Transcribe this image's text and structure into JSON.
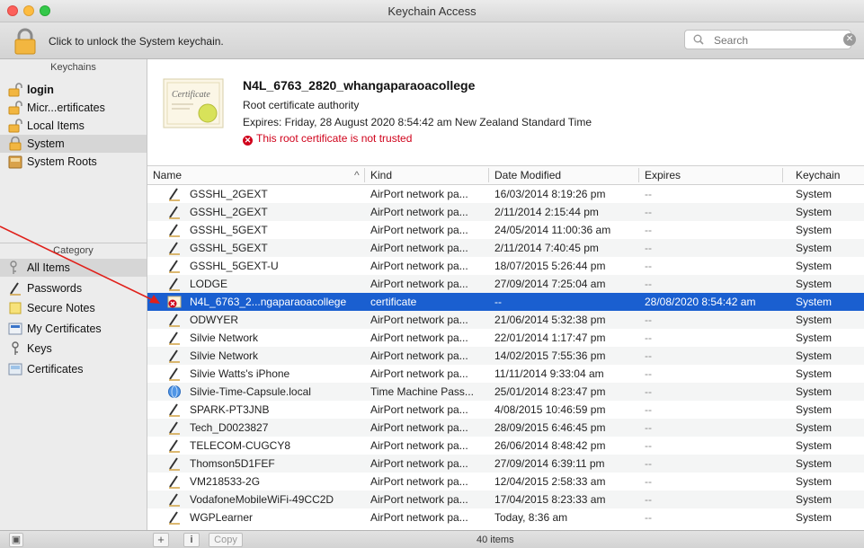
{
  "window": {
    "title": "Keychain Access"
  },
  "toolbar": {
    "unlock_text": "Click to unlock the System keychain.",
    "search_placeholder": "Search"
  },
  "sidebar": {
    "keychains_header": "Keychains",
    "keychains": [
      {
        "label": "login",
        "icon": "lock-open-icon",
        "bold": true
      },
      {
        "label": "Micr...ertificates",
        "icon": "lock-open-icon"
      },
      {
        "label": "Local Items",
        "icon": "lock-open-icon"
      },
      {
        "label": "System",
        "icon": "lock-closed-icon",
        "selected": true
      },
      {
        "label": "System Roots",
        "icon": "cabinet-icon"
      }
    ],
    "category_header": "Category",
    "categories": [
      {
        "label": "All Items",
        "icon": "keys-icon",
        "selected": true
      },
      {
        "label": "Passwords",
        "icon": "pen-icon"
      },
      {
        "label": "Secure Notes",
        "icon": "note-icon"
      },
      {
        "label": "My Certificates",
        "icon": "cert-icon"
      },
      {
        "label": "Keys",
        "icon": "key-icon"
      },
      {
        "label": "Certificates",
        "icon": "certificate-icon"
      }
    ]
  },
  "cert_info": {
    "name": "N4L_6763_2820_whangaparaoacollege",
    "type": "Root certificate authority",
    "expires": "Expires: Friday, 28 August 2020 8:54:42 am New Zealand Standard Time",
    "warning": "This root certificate is not trusted",
    "thumb_text": "Certificate"
  },
  "table": {
    "columns": [
      "Name",
      "Kind",
      "Date Modified",
      "Expires",
      "Keychain"
    ],
    "rows": [
      {
        "name": "GSSHL_2GEXT",
        "kind": "AirPort network pa...",
        "date": "16/03/2014 8:19:26 pm",
        "expires": "--",
        "keychain": "System",
        "icon": "pen-icon"
      },
      {
        "name": "GSSHL_2GEXT",
        "kind": "AirPort network pa...",
        "date": "2/11/2014 2:15:44 pm",
        "expires": "--",
        "keychain": "System",
        "icon": "pen-icon"
      },
      {
        "name": "GSSHL_5GEXT",
        "kind": "AirPort network pa...",
        "date": "24/05/2014 11:00:36 am",
        "expires": "--",
        "keychain": "System",
        "icon": "pen-icon"
      },
      {
        "name": "GSSHL_5GEXT",
        "kind": "AirPort network pa...",
        "date": "2/11/2014 7:40:45 pm",
        "expires": "--",
        "keychain": "System",
        "icon": "pen-icon"
      },
      {
        "name": "GSSHL_5GEXT-U",
        "kind": "AirPort network pa...",
        "date": "18/07/2015 5:26:44 pm",
        "expires": "--",
        "keychain": "System",
        "icon": "pen-icon"
      },
      {
        "name": "LODGE",
        "kind": "AirPort network pa...",
        "date": "27/09/2014 7:25:04 am",
        "expires": "--",
        "keychain": "System",
        "icon": "pen-icon"
      },
      {
        "name": "N4L_6763_2...ngaparaoacollege",
        "kind": "certificate",
        "date": "--",
        "expires": "28/08/2020 8:54:42 am",
        "keychain": "System",
        "icon": "cert-untrusted-icon",
        "selected": true
      },
      {
        "name": "ODWYER",
        "kind": "AirPort network pa...",
        "date": "21/06/2014 5:32:38 pm",
        "expires": "--",
        "keychain": "System",
        "icon": "pen-icon"
      },
      {
        "name": "Silvie Network",
        "kind": "AirPort network pa...",
        "date": "22/01/2014 1:17:47 pm",
        "expires": "--",
        "keychain": "System",
        "icon": "pen-icon"
      },
      {
        "name": "Silvie Network",
        "kind": "AirPort network pa...",
        "date": "14/02/2015 7:55:36 pm",
        "expires": "--",
        "keychain": "System",
        "icon": "pen-icon"
      },
      {
        "name": "Silvie Watts's iPhone",
        "kind": "AirPort network pa...",
        "date": "11/11/2014 9:33:04 am",
        "expires": "--",
        "keychain": "System",
        "icon": "pen-icon"
      },
      {
        "name": "Silvie-Time-Capsule.local",
        "kind": "Time Machine Pass...",
        "date": "25/01/2014 8:23:47 pm",
        "expires": "--",
        "keychain": "System",
        "icon": "globe-icon"
      },
      {
        "name": "SPARK-PT3JNB",
        "kind": "AirPort network pa...",
        "date": "4/08/2015 10:46:59 pm",
        "expires": "--",
        "keychain": "System",
        "icon": "pen-icon"
      },
      {
        "name": "Tech_D0023827",
        "kind": "AirPort network pa...",
        "date": "28/09/2015 6:46:45 pm",
        "expires": "--",
        "keychain": "System",
        "icon": "pen-icon"
      },
      {
        "name": "TELECOM-CUGCY8",
        "kind": "AirPort network pa...",
        "date": "26/06/2014 8:48:42 pm",
        "expires": "--",
        "keychain": "System",
        "icon": "pen-icon"
      },
      {
        "name": "Thomson5D1FEF",
        "kind": "AirPort network pa...",
        "date": "27/09/2014 6:39:11 pm",
        "expires": "--",
        "keychain": "System",
        "icon": "pen-icon"
      },
      {
        "name": "VM218533-2G",
        "kind": "AirPort network pa...",
        "date": "12/04/2015 2:58:33 am",
        "expires": "--",
        "keychain": "System",
        "icon": "pen-icon"
      },
      {
        "name": "VodafoneMobileWiFi-49CC2D",
        "kind": "AirPort network pa...",
        "date": "17/04/2015 8:23:33 am",
        "expires": "--",
        "keychain": "System",
        "icon": "pen-icon"
      },
      {
        "name": "WGPLearner",
        "kind": "AirPort network pa...",
        "date": "Today, 8:36 am",
        "expires": "--",
        "keychain": "System",
        "icon": "pen-icon"
      }
    ]
  },
  "statusbar": {
    "add_label": "+",
    "info_label": "i",
    "copy_label": "Copy",
    "count": "40 items"
  },
  "colors": {
    "selection": "#1a5fd0",
    "warning": "#d0021b",
    "annotation_arrow": "#e0201a"
  }
}
